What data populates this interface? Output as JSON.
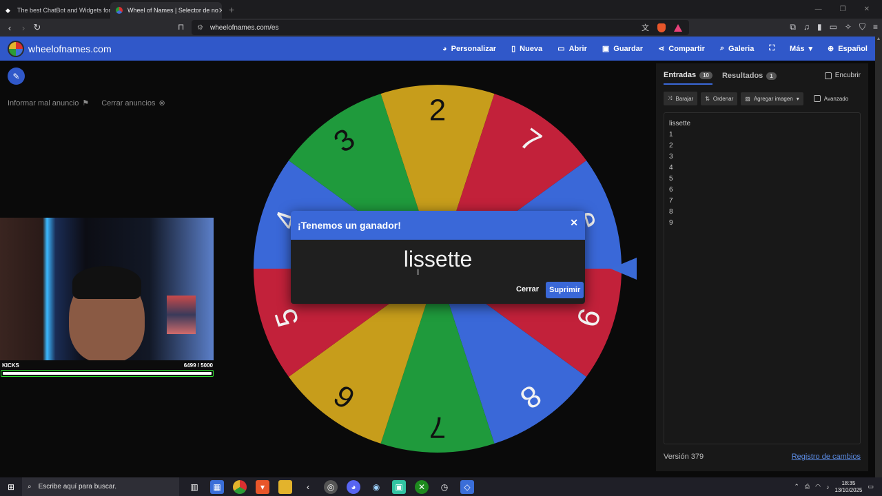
{
  "browser": {
    "tabs": [
      {
        "title": "The best ChatBot and Widgets for Ki",
        "active": false
      },
      {
        "title": "Wheel of Names | Selector de no",
        "active": true
      }
    ],
    "url": "wheelofnames.com/es"
  },
  "site": {
    "brand": "wheelofnames.com",
    "nav": [
      {
        "label": "Personalizar",
        "icon": "palette-icon"
      },
      {
        "label": "Nueva",
        "icon": "file-icon"
      },
      {
        "label": "Abrir",
        "icon": "folder-icon"
      },
      {
        "label": "Guardar",
        "icon": "save-icon"
      },
      {
        "label": "Compartir",
        "icon": "share-icon"
      },
      {
        "label": "Galeria",
        "icon": "search-icon"
      },
      {
        "label": "",
        "icon": "fullscreen-icon"
      },
      {
        "label": "Más",
        "icon": "chevron-down-icon"
      },
      {
        "label": "Español",
        "icon": "globe-icon"
      }
    ]
  },
  "left": {
    "report_ad": "Informar mal anuncio",
    "close_ads": "Cerrar anuncios"
  },
  "stream_overlay": {
    "label": "KICKS",
    "count": "6499 / 5000",
    "progress": 1.0,
    "bar_color": "#2fe02f"
  },
  "wheel": {
    "segments": [
      {
        "label": "2",
        "color": "#c79d1b"
      },
      {
        "label": "7",
        "color": "#c2213a"
      },
      {
        "label": "e",
        "color": "#3a68d8"
      },
      {
        "label": "9",
        "color": "#c2213a"
      },
      {
        "label": "8",
        "color": "#3a68d8"
      },
      {
        "label": "7",
        "color": "#1f9a3c"
      },
      {
        "label": "6",
        "color": "#c79d1b"
      },
      {
        "label": "5",
        "color": "#c2213a"
      },
      {
        "label": "4",
        "color": "#3a68d8"
      },
      {
        "label": "3",
        "color": "#1f9a3c"
      }
    ],
    "pointer_color": "#3a6ad6"
  },
  "modal": {
    "title": "¡Tenemos un ganador!",
    "winner": "lissette",
    "close_label": "Cerrar",
    "delete_label": "Suprimir"
  },
  "panel": {
    "tab_entries": "Entradas",
    "entries_count": "10",
    "tab_results": "Resultados",
    "results_count": "1",
    "hide_label": "Encubrir",
    "shuffle": "Barajar",
    "sort": "Ordenar",
    "add_image": "Agregar imagen",
    "advanced": "Avanzado",
    "entries": [
      "lissette",
      "1",
      "2",
      "3",
      "4",
      "5",
      "6",
      "7",
      "8",
      "9"
    ],
    "version": "Versión 379",
    "changelog": "Registro de cambios"
  },
  "taskbar": {
    "search_placeholder": "Escribe aquí para buscar.",
    "time": "18:35",
    "date": "13/10/2025"
  }
}
